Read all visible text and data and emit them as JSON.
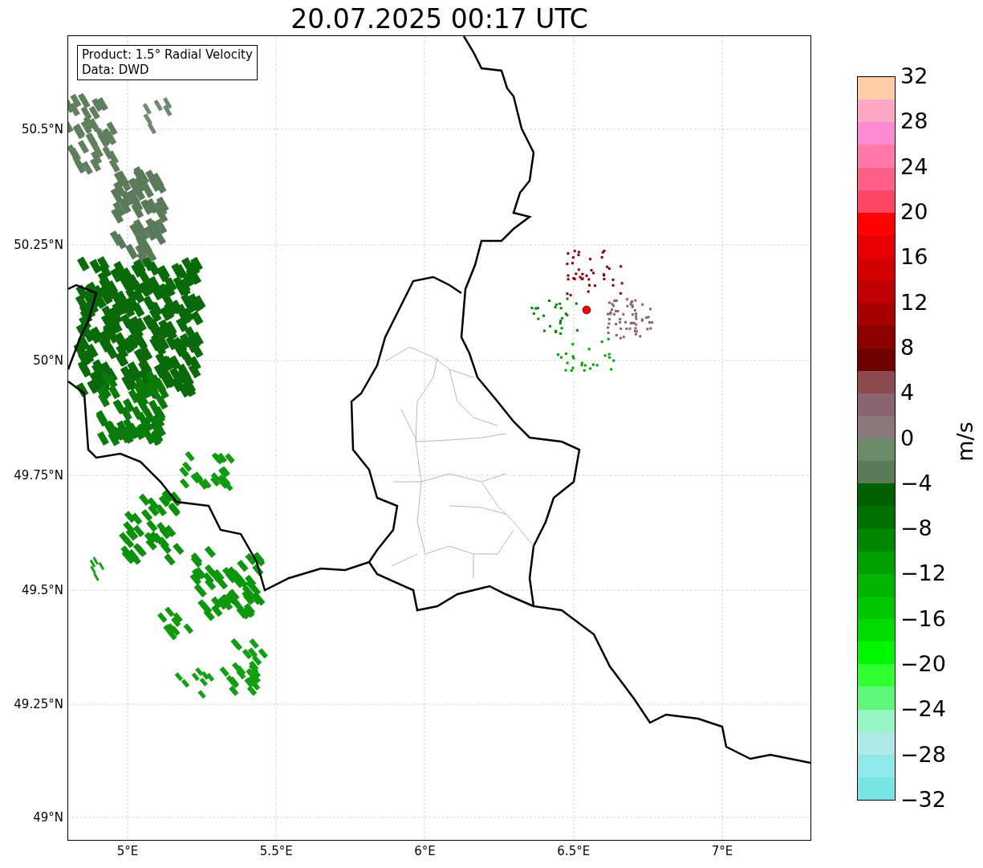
{
  "title": "20.07.2025 00:17 UTC",
  "info_box": [
    "Product: 1.5° Radial Velocity",
    "Data: DWD"
  ],
  "lat_ticks": [
    "50.5°N",
    "50.25°N",
    "50°N",
    "49.75°N",
    "49.5°N",
    "49.25°N",
    "49°N"
  ],
  "lon_ticks": [
    "5°E",
    "5.5°E",
    "6°E",
    "6.5°E",
    "7°E"
  ],
  "colorbar": {
    "label": "m/s",
    "ticks": [
      "32",
      "28",
      "24",
      "20",
      "16",
      "12",
      "8",
      "4",
      "0",
      "−4",
      "−8",
      "−12",
      "−16",
      "−20",
      "−24",
      "−28",
      "−32"
    ],
    "segments": [
      {
        "color": "#ffcca9"
      },
      {
        "color": "#ffa8c4"
      },
      {
        "color": "#ff8ad4"
      },
      {
        "color": "#ff78a8"
      },
      {
        "color": "#ff6088"
      },
      {
        "color": "#ff4566"
      },
      {
        "color": "#ff0000"
      },
      {
        "color": "#e80000"
      },
      {
        "color": "#d40000"
      },
      {
        "color": "#c00000"
      },
      {
        "color": "#a80000"
      },
      {
        "color": "#8c0000"
      },
      {
        "color": "#700000"
      },
      {
        "color": "#8a4a50"
      },
      {
        "color": "#8a6470"
      },
      {
        "color": "#8a7878"
      },
      {
        "color": "#6a8a6a"
      },
      {
        "color": "#5a7a5a"
      },
      {
        "color": "#006000"
      },
      {
        "color": "#007000"
      },
      {
        "color": "#008800"
      },
      {
        "color": "#00a000"
      },
      {
        "color": "#00b400"
      },
      {
        "color": "#00c800"
      },
      {
        "color": "#00dc00"
      },
      {
        "color": "#00f800"
      },
      {
        "color": "#30ff30"
      },
      {
        "color": "#60f87a"
      },
      {
        "color": "#98f4c0"
      },
      {
        "color": "#aee8e8"
      },
      {
        "color": "#90e8e8"
      },
      {
        "color": "#78e4e4"
      }
    ]
  }
}
